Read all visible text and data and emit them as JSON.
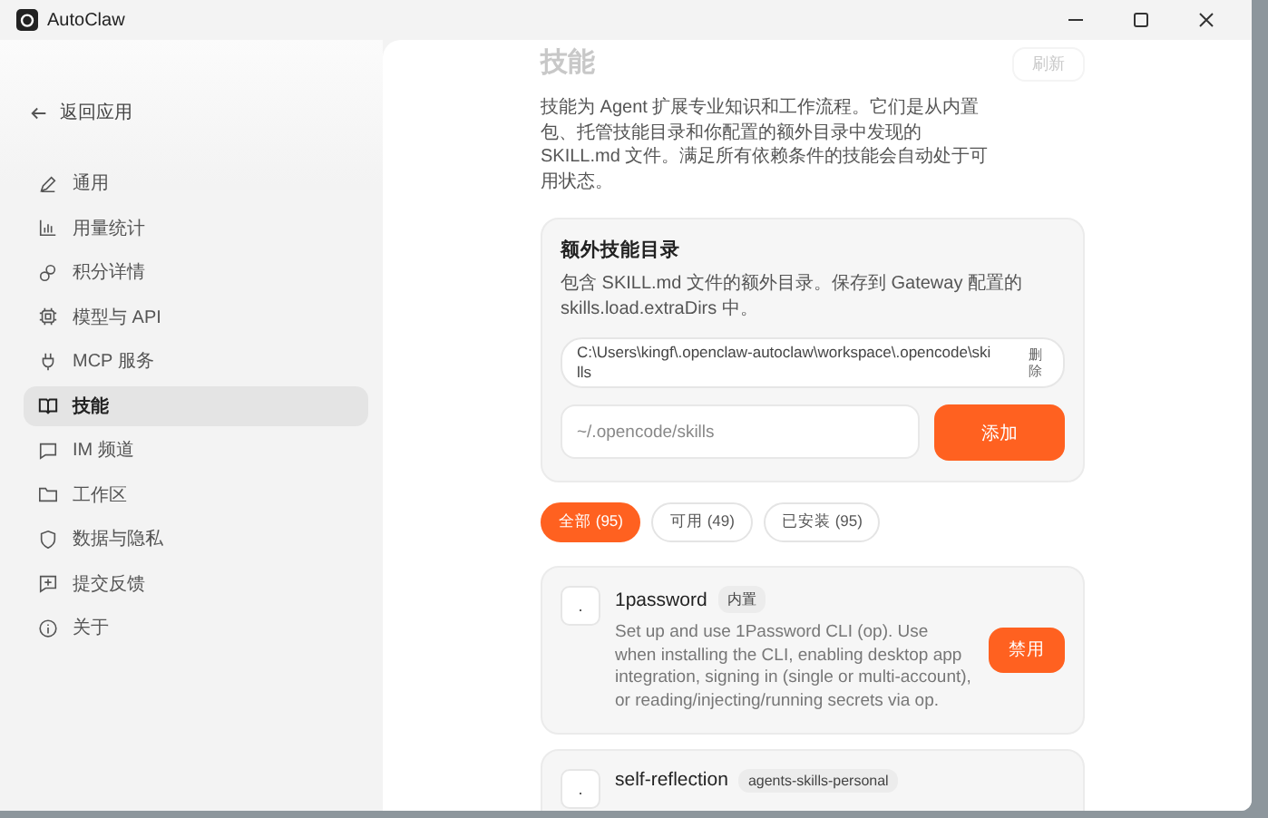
{
  "window": {
    "title": "AutoClaw"
  },
  "sidebar": {
    "back": "返回应用",
    "items": [
      {
        "label": "通用",
        "selected": false
      },
      {
        "label": "用量统计",
        "selected": false
      },
      {
        "label": "积分详情",
        "selected": false
      },
      {
        "label": "模型与 API",
        "selected": false
      },
      {
        "label": "MCP 服务",
        "selected": false
      },
      {
        "label": "技能",
        "selected": true
      },
      {
        "label": "IM 频道",
        "selected": false
      },
      {
        "label": "工作区",
        "selected": false
      },
      {
        "label": "数据与隐私",
        "selected": false
      },
      {
        "label": "提交反馈",
        "selected": false
      },
      {
        "label": "关于",
        "selected": false
      }
    ]
  },
  "page": {
    "title": "技能",
    "refresh": "刷新",
    "description": "技能为 Agent 扩展专业知识和工作流程。它们是从内置包、托管技能目录和你配置的额外目录中发现的 SKILL.md 文件。满足所有依赖条件的技能会自动处于可用状态。"
  },
  "extra_dirs": {
    "title": "额外技能目录",
    "description": "包含 SKILL.md 文件的额外目录。保存到 Gateway 配置的 skills.load.extraDirs 中。",
    "paths": [
      {
        "path": "C:\\Users\\kingf\\.openclaw-autoclaw\\workspace\\.opencode\\skills",
        "remove": "删除"
      }
    ],
    "input": {
      "placeholder": "~/.opencode/skills"
    },
    "add_button": "添加"
  },
  "filters": [
    {
      "label": "全部 (95)",
      "selected": true
    },
    {
      "label": "可用 (49)",
      "selected": false
    },
    {
      "label": "已安装 (95)",
      "selected": false
    }
  ],
  "skills": [
    {
      "icon": ".",
      "name": "1password",
      "tag": "内置",
      "description": "Set up and use 1Password CLI (op). Use when installing the CLI, enabling desktop app integration, signing in (single or multi-account), or reading/injecting/running secrets via op.",
      "action": "禁用"
    },
    {
      "icon": ".",
      "name": "self-reflection",
      "tag": "agents-skills-personal"
    }
  ]
}
